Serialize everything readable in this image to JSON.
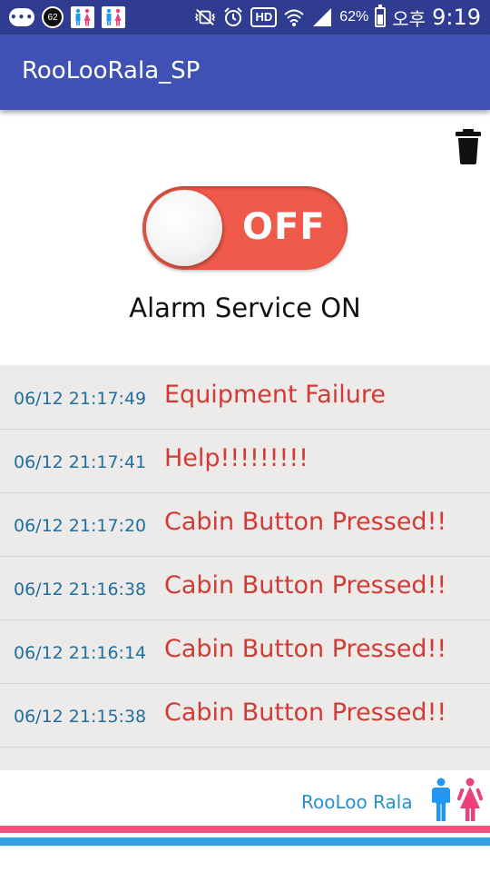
{
  "status_bar": {
    "notification_count": "62",
    "battery_percent": "62%",
    "ampm": "오후",
    "time": "9:19",
    "hd_label": "HD",
    "icons": [
      "chat-icon",
      "notification-count-icon",
      "restroom-app-icon",
      "restroom-app-icon",
      "mute-vibrate-icon",
      "alarm-clock-icon",
      "hd-voice-icon",
      "wifi-icon",
      "cell-signal-icon",
      "battery-icon"
    ]
  },
  "app_bar": {
    "title": "RooLooRala_SP"
  },
  "toolbar": {
    "delete_icon": "trash-icon"
  },
  "alarm_toggle": {
    "label": "OFF",
    "state": "off",
    "track_color": "#f05a4a"
  },
  "alarm_status": "Alarm Service ON",
  "log": [
    {
      "time": "06/12 21:17:49",
      "message": "Equipment Failure"
    },
    {
      "time": "06/12 21:17:41",
      "message": "Help!!!!!!!!!"
    },
    {
      "time": "06/12 21:17:20",
      "message": "Cabin Button Pressed!!"
    },
    {
      "time": "06/12 21:16:38",
      "message": "Cabin Button Pressed!!"
    },
    {
      "time": "06/12 21:16:14",
      "message": "Cabin Button Pressed!!"
    },
    {
      "time": "06/12 21:15:38",
      "message": "Cabin Button Pressed!!"
    }
  ],
  "footer": {
    "brand": "RooLoo Rala"
  },
  "colors": {
    "app_bar": "#3f51b5",
    "status_bar": "#2f3c8f",
    "log_time": "#1f6fa0",
    "log_message": "#d13b35",
    "stripe_pink": "#f0557f",
    "stripe_blue": "#2ea3e0"
  }
}
